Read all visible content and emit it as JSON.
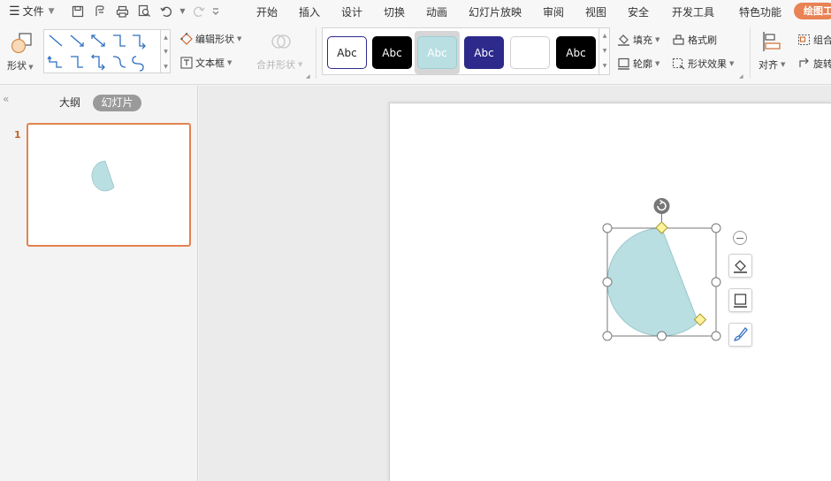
{
  "menubar": {
    "file_label": "文件",
    "tabs": [
      "开始",
      "插入",
      "设计",
      "切换",
      "动画",
      "幻灯片放映",
      "审阅",
      "视图",
      "安全",
      "开发工具",
      "特色功能"
    ],
    "active_tab": "绘图工具"
  },
  "ribbon": {
    "shape_label": "形状",
    "edit_shape": "编辑形状",
    "text_box": "文本框",
    "merge_shape": "合并形状",
    "style_swatches": [
      {
        "label": "Abc",
        "bg": "#ffffff",
        "fg": "#222222",
        "border": "#2d2a8c"
      },
      {
        "label": "Abc",
        "bg": "#000000",
        "fg": "#ffffff",
        "border": "#000000"
      },
      {
        "label": "Abc",
        "bg": "#b9dfe3",
        "fg": "#ffffff",
        "border": "#9ccfd4"
      },
      {
        "label": "Abc",
        "bg": "#2d2a8c",
        "fg": "#ffffff",
        "border": "#2d2a8c"
      },
      {
        "label": "",
        "bg": "#ffffff",
        "fg": "#222222",
        "border": "#cfcfcf"
      },
      {
        "label": "Abc",
        "bg": "#000000",
        "fg": "#ffffff",
        "border": "#000000"
      }
    ],
    "fill": "填充",
    "outline": "轮廓",
    "format_painter": "格式刷",
    "shape_effect": "形状效果",
    "align": "对齐",
    "group": "组合",
    "rotate": "旋转"
  },
  "panel": {
    "tab_outline": "大纲",
    "tab_slides": "幻灯片",
    "slide_number": "1"
  },
  "colors": {
    "accent": "#e98254",
    "shape_fill": "#b9dfe3",
    "handle_yellow": "#fff29a"
  }
}
